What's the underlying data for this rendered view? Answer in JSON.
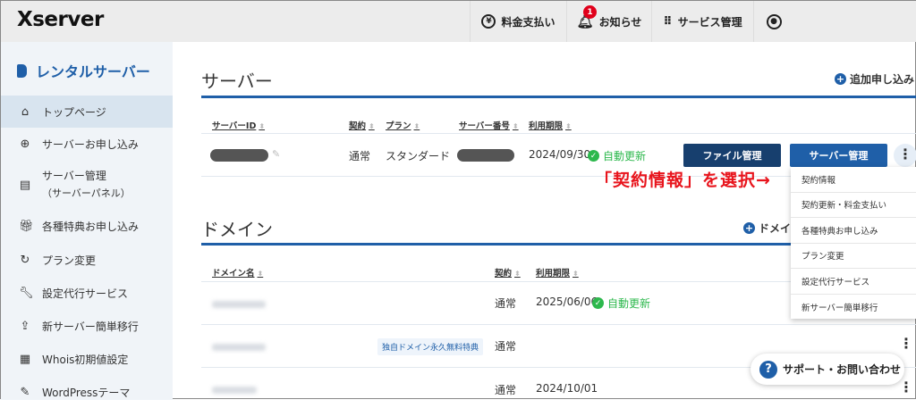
{
  "header": {
    "logo": "Xserver",
    "payment": "料金支払い",
    "notifications": "お知らせ",
    "notification_count": "1",
    "services": "サービス管理"
  },
  "sidebar": {
    "title": "レンタルサーバー",
    "items": [
      {
        "label": "トップページ",
        "icon": "home-icon",
        "active": true
      },
      {
        "label": "サーバーお申し込み",
        "icon": "plus-circle-icon"
      },
      {
        "label": "サーバー管理",
        "sub": "（サーバーパネル）",
        "icon": "server-icon"
      },
      {
        "label": "各種特典お申し込み",
        "icon": "gift-icon"
      },
      {
        "label": "プラン変更",
        "icon": "refresh-icon"
      },
      {
        "label": "設定代行サービス",
        "icon": "wrench-icon"
      },
      {
        "label": "新サーバー簡単移行",
        "icon": "upload-icon"
      },
      {
        "label": "Whois初期値設定",
        "icon": "document-icon"
      },
      {
        "label": "WordPressテーマ",
        "icon": "edit-icon"
      }
    ]
  },
  "server": {
    "title": "サーバー",
    "add": "追加申し込み",
    "columns": [
      "サーバーID",
      "契約",
      "プラン",
      "サーバー番号",
      "利用期限"
    ],
    "row": {
      "contract": "通常",
      "plan": "スタンダード",
      "expiry": "2024/09/30",
      "auto": "自動更新"
    },
    "file_button": "ファイル管理",
    "manage_button": "サーバー管理"
  },
  "annotation": "「契約情報」を選択→",
  "menu": [
    "契約情報",
    "契約更新・料金支払い",
    "各種特典お申し込み",
    "プラン変更",
    "設定代行サービス",
    "新サーバー簡単移行"
  ],
  "domain": {
    "title": "ドメイン",
    "add": "ドメイ",
    "columns": [
      "ドメイン名",
      "契約",
      "利用期限"
    ],
    "rows": [
      {
        "contract": "通常",
        "expiry": "2025/06/06",
        "auto": "自動更新"
      },
      {
        "contract": "通常",
        "tag": "独自ドメイン永久無料特典"
      },
      {
        "contract": "通常",
        "expiry": "2024/10/01"
      }
    ]
  },
  "support": "サポート・お問い合わせ",
  "colors": {
    "brand": "#1f5fa8",
    "file_button": "#173f6e",
    "ok": "#2db84d",
    "annotation": "#e8141c"
  }
}
